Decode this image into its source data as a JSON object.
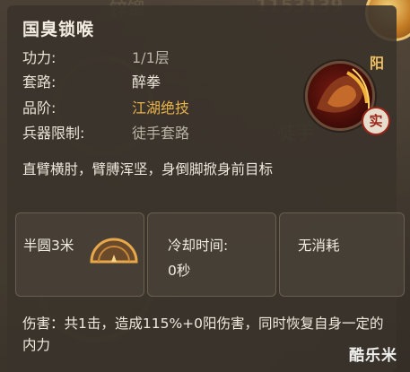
{
  "skill": {
    "name": "国臭锁喉",
    "stats": [
      {
        "key": "功力:",
        "value": "1/1层",
        "tone": "gray"
      },
      {
        "key": "套路:",
        "value": "醉拳",
        "tone": "white"
      },
      {
        "key": "品阶:",
        "value": "江湖绝技",
        "tone": "gold"
      },
      {
        "key": "兵器限制:",
        "value": "徒手套路",
        "tone": "gray"
      }
    ],
    "description": "直臂横肘，臂膊浑坚，身倒脚掀身前目标",
    "yang_badge": "阳",
    "shi_badge": "实"
  },
  "cards": {
    "range": "半圆3米",
    "cooldown_label": "冷却时间:",
    "cooldown_value": "0秒",
    "cost": "无消耗"
  },
  "damage_text": "伤害：共1击，造成115%+0阳伤害，同时恢复自身一定的内力",
  "watermark": "酷乐米",
  "colors": {
    "accent_gold": "#e6b24a",
    "badge_red": "#9b2418"
  }
}
